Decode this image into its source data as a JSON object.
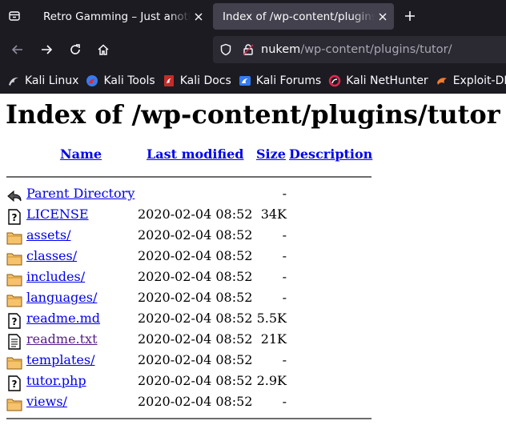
{
  "browser": {
    "tabs": [
      {
        "title": "Retro Gamming – Just anoth",
        "active": false
      },
      {
        "title": "Index of /wp-content/plugins",
        "active": true
      }
    ],
    "url_host": "nukem",
    "url_path": "/wp-content/plugins/tutor/",
    "bookmarks": [
      {
        "label": "Kali Linux",
        "icon": "kali-dragon-icon"
      },
      {
        "label": "Kali Tools",
        "icon": "kali-tools-icon"
      },
      {
        "label": "Kali Docs",
        "icon": "kali-docs-icon"
      },
      {
        "label": "Kali Forums",
        "icon": "kali-forums-icon"
      },
      {
        "label": "Kali NetHunter",
        "icon": "kali-nethunter-icon"
      },
      {
        "label": "Exploit-DB",
        "icon": "exploit-db-icon"
      }
    ]
  },
  "page": {
    "title": "Index of /wp-content/plugins/tutor",
    "columns": {
      "name": "Name",
      "modified": "Last modified",
      "size": "Size",
      "description": "Description"
    },
    "rows": [
      {
        "name": "Parent Directory",
        "modified": "",
        "size": "-",
        "icon": "back-icon",
        "visited": false
      },
      {
        "name": "LICENSE",
        "modified": "2020-02-04 08:52",
        "size": "34K",
        "icon": "unknown-file-icon",
        "visited": false
      },
      {
        "name": "assets/",
        "modified": "2020-02-04 08:52",
        "size": "-",
        "icon": "folder-icon",
        "visited": false
      },
      {
        "name": "classes/",
        "modified": "2020-02-04 08:52",
        "size": "-",
        "icon": "folder-icon",
        "visited": false
      },
      {
        "name": "includes/",
        "modified": "2020-02-04 08:52",
        "size": "-",
        "icon": "folder-icon",
        "visited": false
      },
      {
        "name": "languages/",
        "modified": "2020-02-04 08:52",
        "size": "-",
        "icon": "folder-icon",
        "visited": false
      },
      {
        "name": "readme.md",
        "modified": "2020-02-04 08:52",
        "size": "5.5K",
        "icon": "unknown-file-icon",
        "visited": false
      },
      {
        "name": "readme.txt",
        "modified": "2020-02-04 08:52",
        "size": "21K",
        "icon": "text-file-icon",
        "visited": true
      },
      {
        "name": "templates/",
        "modified": "2020-02-04 08:52",
        "size": "-",
        "icon": "folder-icon",
        "visited": false
      },
      {
        "name": "tutor.php",
        "modified": "2020-02-04 08:52",
        "size": "2.9K",
        "icon": "unknown-file-icon",
        "visited": false
      },
      {
        "name": "views/",
        "modified": "2020-02-04 08:52",
        "size": "-",
        "icon": "folder-icon",
        "visited": false
      }
    ]
  }
}
